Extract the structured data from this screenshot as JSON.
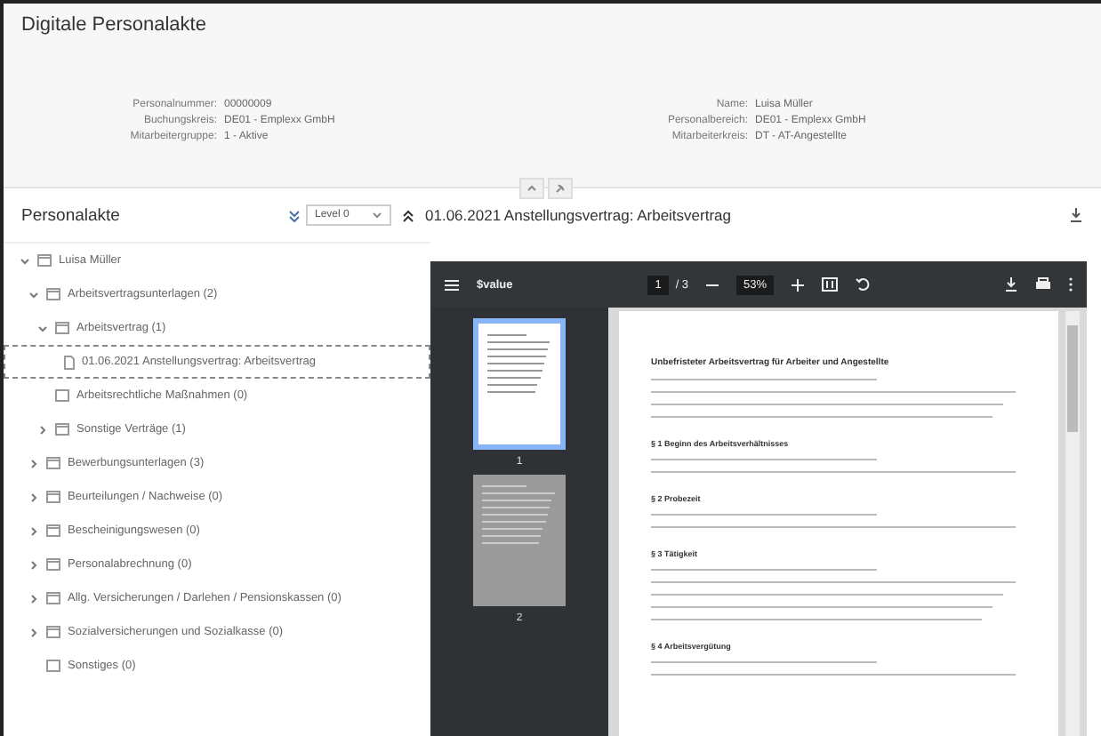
{
  "title": "Digitale Personalakte",
  "fields_left": [
    {
      "label": "Personalnummer:",
      "value": "00000009"
    },
    {
      "label": "Buchungskreis:",
      "value": "DE01 - Emplexx GmbH"
    },
    {
      "label": "Mitarbeitergruppe:",
      "value": "1 - Aktive"
    }
  ],
  "fields_right": [
    {
      "label": "Name:",
      "value": "Luisa Müller"
    },
    {
      "label": "Personalbereich:",
      "value": "DE01 - Emplexx GmbH"
    },
    {
      "label": "Mitarbeiterkreis:",
      "value": "DT - AT-Angestellte"
    }
  ],
  "toolbar": {
    "title": "Personalakte",
    "level": "Level 0",
    "document": "01.06.2021 Anstellungsvertrag: Arbeitsvertrag"
  },
  "tree": [
    {
      "label": "Luisa Müller",
      "kind": "folder",
      "expanded": true,
      "children": [
        {
          "label": "Arbeitsvertragsunterlagen (2)",
          "kind": "folder",
          "expanded": true,
          "children": [
            {
              "label": "Arbeitsvertrag (1)",
              "kind": "folder",
              "expanded": true,
              "children": [
                {
                  "label": "01.06.2021 Anstellungsvertrag: Arbeitsvertrag",
                  "kind": "document",
                  "selected": true
                }
              ]
            },
            {
              "label": "Arbeitsrechtliche Maßnahmen (0)",
              "kind": "empty",
              "selected": false
            },
            {
              "label": "Sonstige Verträge (1)",
              "kind": "folder",
              "expanded": false
            }
          ]
        },
        {
          "label": "Bewerbungsunterlagen (3)",
          "kind": "folder",
          "expanded": false
        },
        {
          "label": "Beurteilungen / Nachweise (0)",
          "kind": "folder",
          "expanded": false
        },
        {
          "label": "Bescheinigungswesen (0)",
          "kind": "folder",
          "expanded": false
        },
        {
          "label": "Personalabrechnung (0)",
          "kind": "folder",
          "expanded": false
        },
        {
          "label": "Allg. Versicherungen / Darlehen / Pensionskassen (0)",
          "kind": "folder",
          "expanded": false
        },
        {
          "label": "Sozialversicherungen und Sozialkasse (0)",
          "kind": "folder",
          "expanded": false
        },
        {
          "label": "Sonstiges (0)",
          "kind": "empty",
          "selected": false
        }
      ]
    }
  ],
  "viewer": {
    "file": "$value",
    "page": "1",
    "pages": "/ 3",
    "zoom": "53%",
    "thumbnails": [
      {
        "label": "1",
        "selected": true
      },
      {
        "label": "2",
        "selected": false
      }
    ],
    "document": {
      "title": "Unbefristeter Arbeitsvertrag für Arbeiter und Angestellte",
      "sections": [
        "§ 1 Beginn des Arbeitsverhältnisses",
        "§ 2 Probezeit",
        "§ 3 Tätigkeit",
        "§ 4 Arbeitsvergütung"
      ]
    }
  }
}
